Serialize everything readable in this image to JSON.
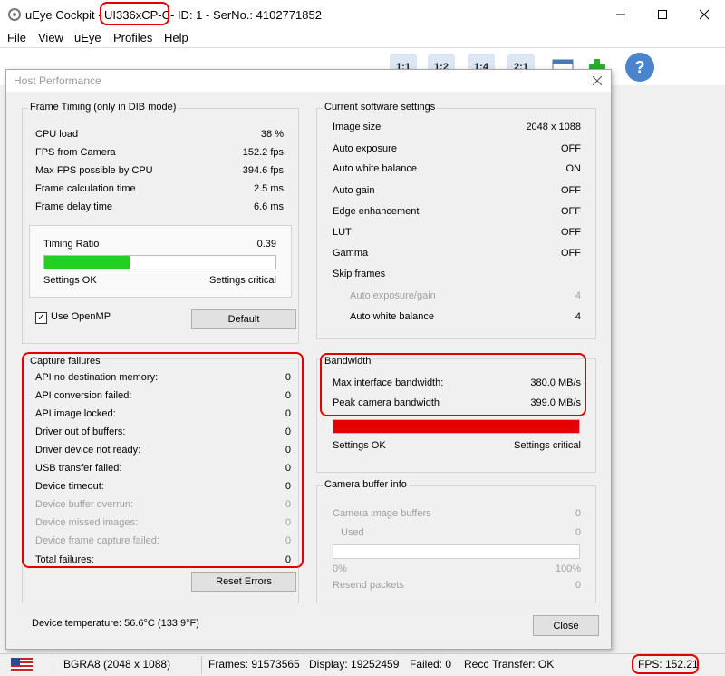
{
  "window": {
    "title_prefix": "uEye Cockpit -",
    "title_model": "UI336xCP-C",
    "title_suffix": "- ID: 1 - SerNo.: 4102771852"
  },
  "menu": [
    "File",
    "View",
    "uEye",
    "Profiles",
    "Help"
  ],
  "toolbar": {
    "zoom_1_1": "1:1",
    "zoom_1_2": "1:2",
    "zoom_1_4": "1:4",
    "zoom_2_1": "2:1",
    "help": "?"
  },
  "dialog": {
    "title": "Host Performance",
    "frame_timing": {
      "label": "Frame Timing (only in DIB mode)",
      "rows": [
        {
          "label": "CPU load",
          "value": "38 %"
        },
        {
          "label": "FPS from Camera",
          "value": "152.2 fps"
        },
        {
          "label": "Max FPS possible by CPU",
          "value": "394.6 fps"
        },
        {
          "label": "Frame calculation time",
          "value": "2.5 ms"
        },
        {
          "label": "Frame delay time",
          "value": "6.6 ms"
        }
      ],
      "timing_ratio_label": "Timing Ratio",
      "timing_ratio_value": "0.39",
      "timing_ratio_fraction": 0.37,
      "settings_ok": "Settings OK",
      "settings_critical": "Settings critical",
      "use_openmp_label": "Use OpenMP",
      "use_openmp_checked": true,
      "default_button": "Default"
    },
    "current_settings": {
      "label": "Current software settings",
      "rows": [
        {
          "label": "Image size",
          "value": "2048 x 1088"
        },
        {
          "label": "Auto exposure",
          "value": "OFF"
        },
        {
          "label": "Auto white balance",
          "value": "ON"
        },
        {
          "label": "Auto gain",
          "value": "OFF"
        },
        {
          "label": "Edge enhancement",
          "value": "OFF"
        },
        {
          "label": "LUT",
          "value": "OFF"
        },
        {
          "label": "Gamma",
          "value": "OFF"
        }
      ],
      "skip_frames_label": "Skip frames",
      "skip_rows": [
        {
          "label": "Auto exposure/gain",
          "value": "4"
        },
        {
          "label": "Auto white balance",
          "value": "4"
        }
      ]
    },
    "capture_failures": {
      "label": "Capture failures",
      "rows": [
        {
          "label": "API no destination memory:",
          "value": "0"
        },
        {
          "label": "API conversion failed:",
          "value": "0"
        },
        {
          "label": "API image locked:",
          "value": "0"
        },
        {
          "label": "Driver out of buffers:",
          "value": "0"
        },
        {
          "label": "Driver device not ready:",
          "value": "0"
        },
        {
          "label": "USB transfer failed:",
          "value": "0"
        },
        {
          "label": "Device timeout:",
          "value": "0"
        },
        {
          "label": "Device buffer overrun:",
          "value": "0"
        },
        {
          "label": "Device missed images:",
          "value": "0"
        },
        {
          "label": "Device frame capture failed:",
          "value": "0"
        },
        {
          "label": "Total failures:",
          "value": "0"
        }
      ],
      "reset_button": "Reset Errors"
    },
    "bandwidth": {
      "label": "Bandwidth",
      "max_interface_label": "Max interface bandwidth:",
      "max_interface_value": "380.0 MB/s",
      "peak_camera_label": "Peak camera bandwidth",
      "peak_camera_value": "399.0 MB/s",
      "fraction": 1.0,
      "settings_ok": "Settings OK",
      "settings_critical": "Settings critical"
    },
    "camera_buffer": {
      "label": "Camera buffer info",
      "image_buffers_label": "Camera image buffers",
      "image_buffers_value": "0",
      "used_label": "Used",
      "used_value": "0",
      "min_label": "0%",
      "max_label": "100%",
      "resend_label": "Resend packets",
      "resend_value": "0"
    },
    "device_temperature": "Device temperature:  56.6°C (133.9°F)",
    "close_button": "Close"
  },
  "statusbar": {
    "format": "BGRA8 (2048 x 1088)",
    "frames": "Frames: 91573565",
    "display": "Display: 19252459",
    "failed": "Failed: 0",
    "recc": "Recc",
    "transfer": "Transfer: OK",
    "fps": "FPS: 152.21"
  },
  "colors": {
    "timing_fill": "#21d021",
    "bandwidth_fill": "#e60000",
    "highlight": "#e00000"
  }
}
